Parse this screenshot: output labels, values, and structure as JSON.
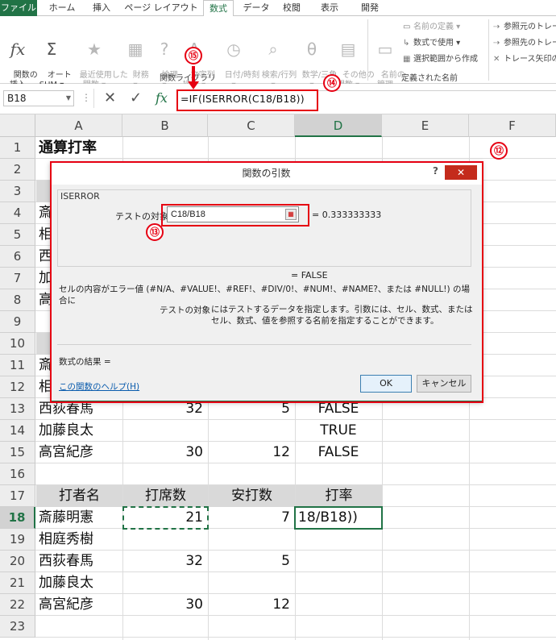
{
  "ribbon_tabs": [
    "ファイル",
    "ホーム",
    "挿入",
    "ページ レイアウト",
    "数式",
    "データ",
    "校閲",
    "表示",
    "開発"
  ],
  "ribbon": {
    "insert_function": "関数の\n挿入",
    "autosum": "オート\nSUM ▾",
    "recent": "最近使用した\n関数 ▾",
    "financial": "財務\n▾",
    "logical": "論理\n▾",
    "text": "文字列\n操作 ▾",
    "datetime": "日付/時刻\n▾",
    "lookup": "検索/行列\n▾",
    "math": "数学/三角\n▾",
    "more": "その他の\n関数 ▾",
    "function_library_label": "関数ライブラリ",
    "name_manager": "名前の\n管理",
    "define_name": "名前の定義 ▾",
    "use_in_formula": "数式で使用 ▾",
    "create_from_selection": "選択範囲から作成",
    "defined_names_label": "定義された名前",
    "trace_precedents": "参照元のトレー",
    "trace_dependents": "参照先のトレー",
    "remove_arrows": "トレース矢印の"
  },
  "formula_bar": {
    "name_box": "B18",
    "dots": "⋮",
    "cancel_symbol": "✕",
    "enter_symbol": "✓",
    "fx_symbol": "fx",
    "formula": "=IF(ISERROR(C18/B18))"
  },
  "columns": [
    "A",
    "B",
    "C",
    "D",
    "E",
    "F"
  ],
  "rows": [
    "1",
    "2",
    "3",
    "4",
    "5",
    "6",
    "7",
    "8",
    "9",
    "10",
    "11",
    "12",
    "13",
    "14",
    "15",
    "16",
    "17",
    "18",
    "19",
    "20",
    "21",
    "22",
    "23"
  ],
  "cells": {
    "title": "通算打率",
    "r13": {
      "name": "西荻春馬",
      "b": "32",
      "c": "5",
      "d": "FALSE"
    },
    "r14": {
      "name": "加藤良太",
      "b": "",
      "c": "",
      "d": "TRUE"
    },
    "r15": {
      "name": "高宮紀彦",
      "b": "30",
      "c": "12",
      "d": "FALSE"
    },
    "r17": {
      "a": "打者名",
      "b": "打席数",
      "c": "安打数",
      "d": "打率"
    },
    "r18": {
      "name": "斎藤明憲",
      "b": "21",
      "c": "7",
      "d": "18/B18))"
    },
    "r19": {
      "name": "相庭秀樹",
      "b": "",
      "c": "",
      "d": ""
    },
    "r20": {
      "name": "西荻春馬",
      "b": "32",
      "c": "5",
      "d": ""
    },
    "r21": {
      "name": "加藤良太",
      "b": "",
      "c": "",
      "d": ""
    },
    "r22": {
      "name": "高宮紀彦",
      "b": "30",
      "c": "12",
      "d": ""
    },
    "partial_a": [
      "斎",
      "相",
      "西",
      "加",
      "高",
      "",
      "",
      "斎",
      "相"
    ]
  },
  "dialog": {
    "title": "関数の引数",
    "help_q": "?",
    "close": "✕",
    "function_name": "ISERROR",
    "arg_label": "テストの対象",
    "arg_value": "C18/B18",
    "arg_eval": "=  0.333333333",
    "result": "=  FALSE",
    "description": "セルの内容がエラー値 (#N/A、#VALUE!、#REF!、#DIV/0!、#NUM!、#NAME?、または #NULL!) の場合に",
    "arg_desc_label": "テストの対象",
    "arg_desc": "にはテストするデータを指定します。引数には、セル、数式、またはセル、数式、値を参照する名前を指定することができます。",
    "formula_result": "数式の結果 =",
    "help_link": "この関数のヘルプ(H)",
    "ok": "OK",
    "cancel": "キャンセル"
  },
  "annotations": {
    "c12": "⑫",
    "c13": "⑬",
    "c14": "⑭",
    "c15": "⑮"
  },
  "colors": {
    "excel_green": "#217346",
    "annotation_red": "#e60012",
    "header_fill": "#d9d9d9"
  }
}
